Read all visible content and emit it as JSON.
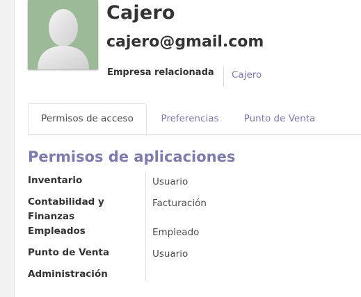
{
  "user": {
    "name": "Cajero",
    "email": "cajero@gmail.com",
    "related_company_label": "Empresa relacionada",
    "related_company_value": "Cajero",
    "avatar_icon": "user-placeholder-icon"
  },
  "tabs": [
    {
      "label": "Permisos de acceso",
      "active": true
    },
    {
      "label": "Preferencias",
      "active": false
    },
    {
      "label": "Punto de Venta",
      "active": false
    }
  ],
  "permissions": {
    "title": "Permisos de aplicaciones",
    "rows": [
      {
        "label": "Inventario",
        "value": "Usuario"
      },
      {
        "label": "Contabilidad y Finanzas",
        "value": "Facturación"
      },
      {
        "label": "Empleados",
        "value": "Empleado"
      },
      {
        "label": "Punto de Venta",
        "value": "Usuario"
      },
      {
        "label": "Administración",
        "value": ""
      }
    ]
  },
  "colors": {
    "accent": "#7c7bad",
    "avatar_bg": "#9cba97"
  }
}
